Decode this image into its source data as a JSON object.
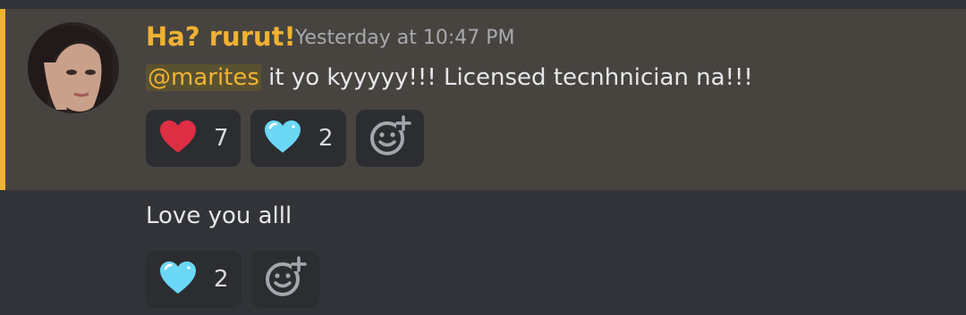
{
  "message": {
    "username": "Ha? rurut!",
    "timestamp": "Yesterday at 10:47 PM",
    "mention": "@marites",
    "text": " it yo kyyyyy!!! Licensed tecnhnician na!!!",
    "reactions": [
      {
        "icon": "red-heart-icon",
        "count": "7"
      },
      {
        "icon": "light-blue-heart-icon",
        "count": "2"
      }
    ],
    "add_reaction_icon": "add-reaction-icon"
  },
  "followup": {
    "text": "Love you alll",
    "reactions": [
      {
        "icon": "light-blue-heart-icon",
        "count": "2"
      }
    ],
    "add_reaction_icon": "add-reaction-icon"
  },
  "colors": {
    "mention_highlight_bg": "#474440",
    "mention_bar": "#f0b232",
    "username": "#f0b232",
    "background": "#313338"
  }
}
